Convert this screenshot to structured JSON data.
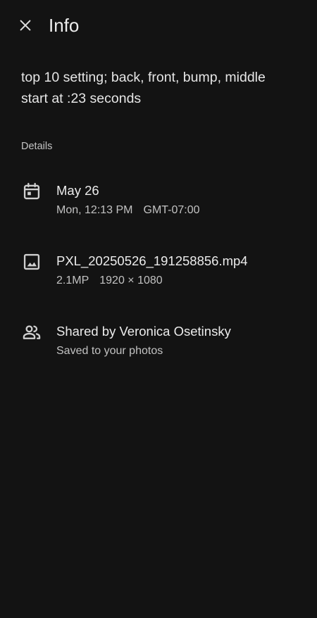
{
  "header": {
    "title": "Info",
    "close_icon": "close-icon"
  },
  "description": "top 10 setting; back, front, bump, middle\nstart at :23 seconds",
  "details": {
    "label": "Details",
    "date": {
      "icon": "calendar-icon",
      "primary": "May 26",
      "secondary": [
        "Mon, 12:13 PM",
        "GMT-07:00"
      ]
    },
    "file": {
      "icon": "image-icon",
      "primary": "PXL_20250526_191258856.mp4",
      "secondary": [
        "2.1MP",
        "1920 × 1080"
      ]
    },
    "share": {
      "icon": "people-icon",
      "primary": "Shared by Veronica Osetinsky",
      "secondary": "Saved to your photos"
    }
  }
}
